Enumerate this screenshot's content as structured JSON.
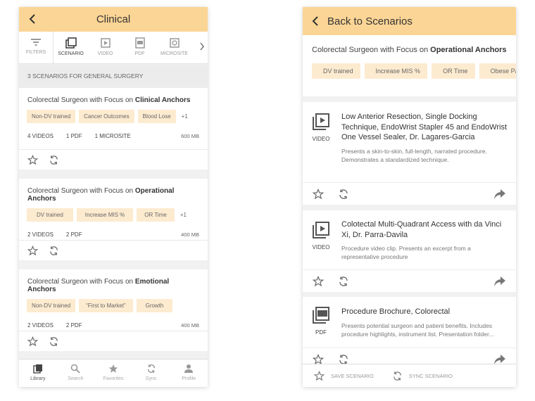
{
  "left": {
    "header": {
      "title": "Clinical"
    },
    "tabs": [
      {
        "label": "FILTERS",
        "icon": "filter-icon"
      },
      {
        "label": "SCENARIO",
        "icon": "scenario-icon",
        "active": true
      },
      {
        "label": "VIDEO",
        "icon": "video-icon"
      },
      {
        "label": "PDF",
        "icon": "pdf-icon"
      },
      {
        "label": "MICROSITE",
        "icon": "microsite-icon"
      }
    ],
    "section_label": "3 SCENARIOS FOR GENERAL SURGERY",
    "cards": [
      {
        "title_prefix": "Colorectal Surgeon with Focus on ",
        "title_bold": "Clinical Anchors",
        "tags": [
          "Non-DV trained",
          "Cancer Outcomes",
          "Blood Lose"
        ],
        "more": "+1",
        "meta": [
          "4 VIDEOS",
          "1 PDF",
          "1 MICROSITE"
        ],
        "size": "600 MB"
      },
      {
        "title_prefix": "Colorectal Surgeon with Focus on ",
        "title_bold": "Operational Anchors",
        "tags": [
          "DV trained",
          "Increase MIS %",
          "OR Time"
        ],
        "more": "+1",
        "meta": [
          "2 VIDEOS",
          "2 PDF"
        ],
        "size": "400 MB"
      },
      {
        "title_prefix": "Colorectal Surgeon with Focus on ",
        "title_bold": "Emotional Anchors",
        "tags": [
          "Non-DV trained",
          "“First to Market”",
          "Growth"
        ],
        "more": "",
        "meta": [
          "2 VIDEOS",
          "2 PDF"
        ],
        "size": "400 MB"
      }
    ],
    "nav": [
      {
        "label": "Library",
        "icon": "library-icon",
        "active": true
      },
      {
        "label": "Search",
        "icon": "search-icon"
      },
      {
        "label": "Favorites",
        "icon": "star-icon"
      },
      {
        "label": "Sync",
        "icon": "sync-icon"
      },
      {
        "label": "Profile",
        "icon": "profile-icon"
      }
    ]
  },
  "right": {
    "header": {
      "title": "Back to Scenarios"
    },
    "scenario": {
      "title_prefix": "Colorectal Surgeon with Focus on ",
      "title_bold": "Operational Anchors",
      "tags": [
        "DV trained",
        "Increase MIS %",
        "OR Time",
        "Obese Pa"
      ]
    },
    "items": [
      {
        "type_label": "VIDEO",
        "icon": "video-play-icon",
        "title": "Low Anterior Resection, Single Docking Technique, EndoWrist Stapler 45 and EndoWrist One Vessel Sealer, Dr. Lagares-Garcia",
        "desc": "Presents a skin-to-skin, full-length, narrated procedure. Demonstrates a standardized technique."
      },
      {
        "type_label": "VIDEO",
        "icon": "video-play-icon",
        "title": "Colotectal Multi-Quadrant Access with da Vinci Xi, Dr. Parra-Davila",
        "desc": "Procedure video clip. Presents an excerpt from a representative procedure"
      },
      {
        "type_label": "PDF",
        "icon": "pdf-doc-icon",
        "title": "Procedure Brochure, Colorectal",
        "desc": "Presents potential surgeon and patient benefits. Includes procedure highlights, instrument list. Presentation folder..."
      }
    ],
    "footer": {
      "save_label": "SAVE SCENARIO",
      "sync_label": "SYNC SCENARIO"
    }
  },
  "colors": {
    "header_bg": "#fbd595",
    "tag_bg": "#fdebd0",
    "page_bg": "#f1f1f1"
  }
}
